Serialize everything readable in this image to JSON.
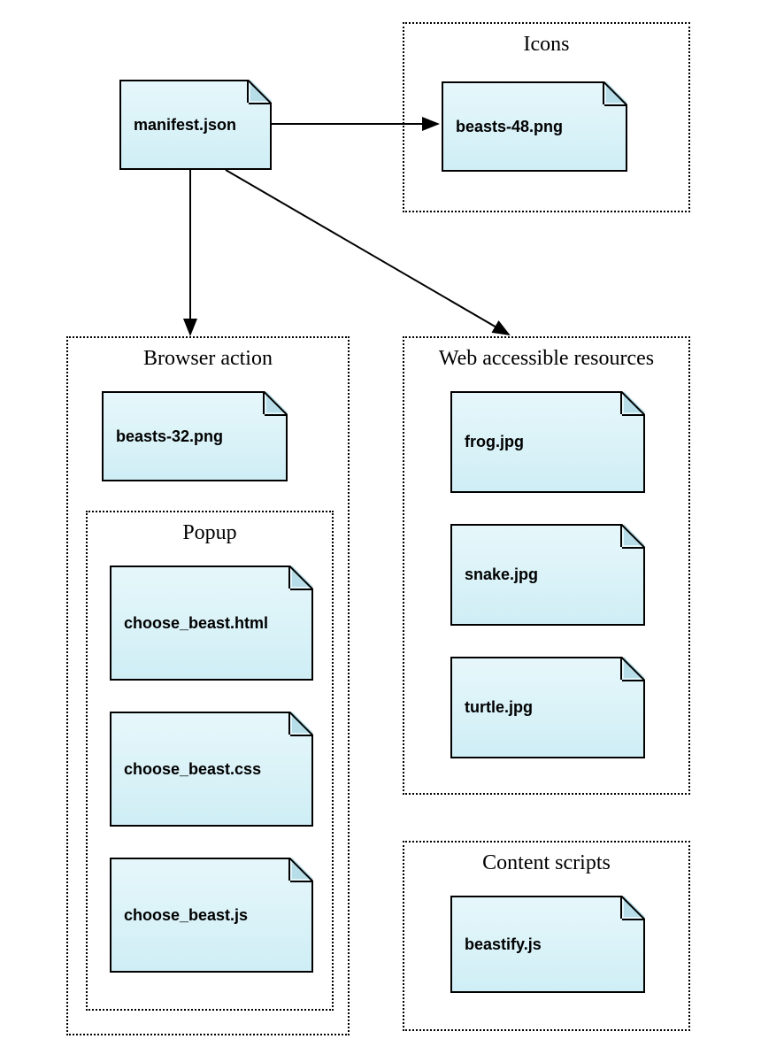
{
  "root": {
    "label": "manifest.json"
  },
  "icons": {
    "title": "Icons",
    "files": [
      {
        "label": "beasts-48.png"
      }
    ]
  },
  "browser_action": {
    "title": "Browser action",
    "files": [
      {
        "label": "beasts-32.png"
      }
    ],
    "popup": {
      "title": "Popup",
      "files": [
        {
          "label": "choose_beast.html"
        },
        {
          "label": "choose_beast.css"
        },
        {
          "label": "choose_beast.js"
        }
      ]
    }
  },
  "web_accessible": {
    "title": "Web accessible resources",
    "files": [
      {
        "label": "frog.jpg"
      },
      {
        "label": "snake.jpg"
      },
      {
        "label": "turtle.jpg"
      }
    ]
  },
  "content_scripts": {
    "title": "Content scripts",
    "files": [
      {
        "label": "beastify.js"
      }
    ]
  }
}
